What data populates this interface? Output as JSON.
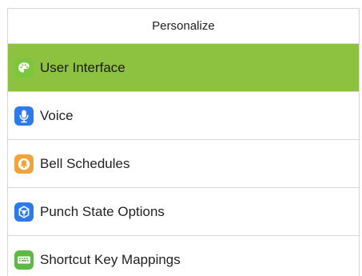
{
  "header": {
    "title": "Personalize"
  },
  "colors": {
    "selected_row_bg": "#8cc23f",
    "border": "#d6d6d6"
  },
  "menu": {
    "items": [
      {
        "label": "User Interface",
        "icon": "palette-icon",
        "icon_color": "#7cc63d",
        "selected": true
      },
      {
        "label": "Voice",
        "icon": "microphone-icon",
        "icon_color": "#2d7be8",
        "selected": false
      },
      {
        "label": "Bell Schedules",
        "icon": "bell-icon",
        "icon_color": "#f0a33a",
        "selected": false
      },
      {
        "label": "Punch State Options",
        "icon": "punch-state-icon",
        "icon_color": "#2d7be8",
        "selected": false
      },
      {
        "label": "Shortcut Key Mappings",
        "icon": "keyboard-icon",
        "icon_color": "#5cb944",
        "selected": false
      }
    ]
  }
}
